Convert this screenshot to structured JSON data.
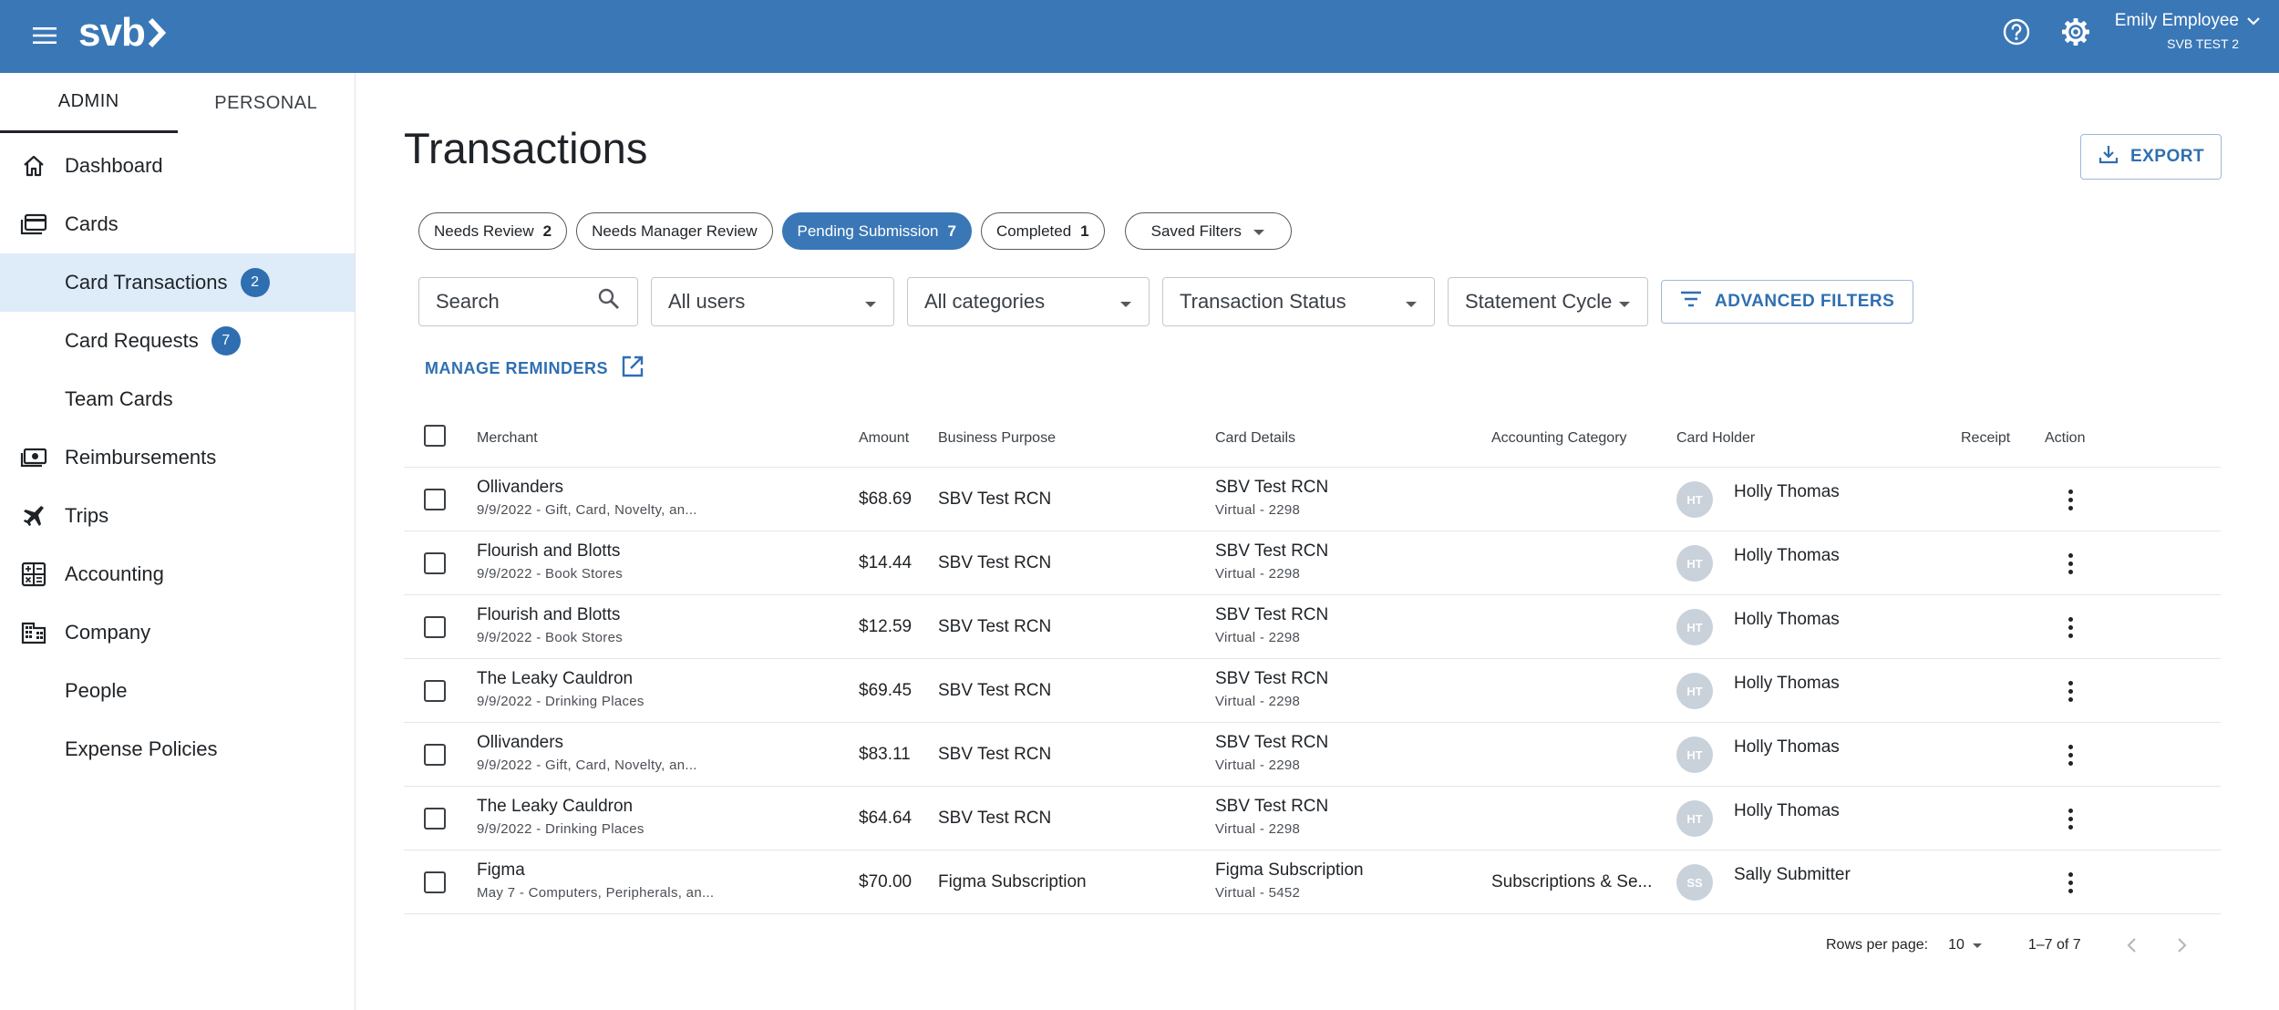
{
  "app": {
    "brand": "svb"
  },
  "user": {
    "name": "Emily Employee",
    "org": "SVB TEST 2"
  },
  "sidebar": {
    "tabs": [
      {
        "label": "ADMIN"
      },
      {
        "label": "PERSONAL"
      }
    ],
    "items": [
      {
        "label": "Dashboard",
        "icon": "home-icon"
      },
      {
        "label": "Cards",
        "icon": "cards-icon"
      },
      {
        "label": "Card Transactions",
        "badge": "2"
      },
      {
        "label": "Card Requests",
        "badge": "7"
      },
      {
        "label": "Team Cards"
      },
      {
        "label": "Reimbursements",
        "icon": "cash-icon"
      },
      {
        "label": "Trips",
        "icon": "airplane-icon"
      },
      {
        "label": "Accounting",
        "icon": "calculator-icon"
      },
      {
        "label": "Company",
        "icon": "building-icon"
      },
      {
        "label": "People"
      },
      {
        "label": "Expense Policies"
      }
    ]
  },
  "main": {
    "title": "Transactions",
    "export_label": "EXPORT",
    "chips": [
      {
        "label": "Needs Review",
        "count": "2"
      },
      {
        "label": "Needs Manager Review"
      },
      {
        "label": "Pending Submission",
        "count": "7"
      },
      {
        "label": "Completed",
        "count": "1"
      },
      {
        "label": "Saved Filters"
      }
    ],
    "filters": {
      "search_placeholder": "Search",
      "users": "All users",
      "categories": "All categories",
      "status": "Transaction Status",
      "cycle": "Statement Cycle",
      "advanced": "ADVANCED FILTERS"
    },
    "manage_reminders": "MANAGE REMINDERS"
  },
  "table": {
    "columns": {
      "merchant": "Merchant",
      "amount": "Amount",
      "purpose": "Business Purpose",
      "card": "Card Details",
      "category": "Accounting Category",
      "holder": "Card Holder",
      "receipt": "Receipt",
      "action": "Action"
    },
    "rows": [
      {
        "merchant": "Ollivanders",
        "meta": "9/9/2022 - Gift, Card, Novelty, an...",
        "amount": "$68.69",
        "purpose": "SBV Test RCN",
        "card": "SBV Test RCN",
        "card_sub": "Virtual - 2298",
        "category": "",
        "initials": "HT",
        "holder": "Holly Thomas"
      },
      {
        "merchant": "Flourish and Blotts",
        "meta": "9/9/2022 - Book Stores",
        "amount": "$14.44",
        "purpose": "SBV Test RCN",
        "card": "SBV Test RCN",
        "card_sub": "Virtual - 2298",
        "category": "",
        "initials": "HT",
        "holder": "Holly Thomas"
      },
      {
        "merchant": "Flourish and Blotts",
        "meta": "9/9/2022 - Book Stores",
        "amount": "$12.59",
        "purpose": "SBV Test RCN",
        "card": "SBV Test RCN",
        "card_sub": "Virtual - 2298",
        "category": "",
        "initials": "HT",
        "holder": "Holly Thomas"
      },
      {
        "merchant": "The Leaky Cauldron",
        "meta": "9/9/2022 - Drinking Places",
        "amount": "$69.45",
        "purpose": "SBV Test RCN",
        "card": "SBV Test RCN",
        "card_sub": "Virtual - 2298",
        "category": "",
        "initials": "HT",
        "holder": "Holly Thomas"
      },
      {
        "merchant": "Ollivanders",
        "meta": "9/9/2022 - Gift, Card, Novelty, an...",
        "amount": "$83.11",
        "purpose": "SBV Test RCN",
        "card": "SBV Test RCN",
        "card_sub": "Virtual - 2298",
        "category": "",
        "initials": "HT",
        "holder": "Holly Thomas"
      },
      {
        "merchant": "The Leaky Cauldron",
        "meta": "9/9/2022 - Drinking Places",
        "amount": "$64.64",
        "purpose": "SBV Test RCN",
        "card": "SBV Test RCN",
        "card_sub": "Virtual - 2298",
        "category": "",
        "initials": "HT",
        "holder": "Holly Thomas"
      },
      {
        "merchant": "Figma",
        "meta": "May 7 - Computers, Peripherals, an...",
        "amount": "$70.00",
        "purpose": "Figma Subscription",
        "card": "Figma Subscription",
        "card_sub": "Virtual - 5452",
        "category": "Subscriptions & Se...",
        "initials": "SS",
        "holder": "Sally Submitter"
      }
    ]
  },
  "pagination": {
    "rows_per_page_label": "Rows per page:",
    "rows_per_page": "10",
    "range": "1–7 of 7"
  },
  "colors": {
    "brand": "#3a77b6",
    "link": "#2f6fb1",
    "active_nav_bg": "#deebf9",
    "avatar": "#c9d1db"
  }
}
